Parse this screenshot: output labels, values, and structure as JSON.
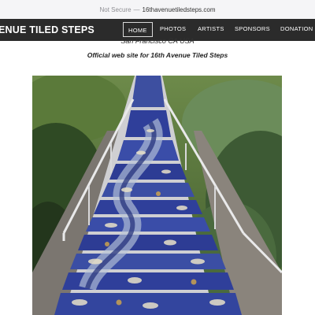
{
  "browser": {
    "secure_label": "Not Secure",
    "separator": "—",
    "url": "16thavenuetiledsteps.com"
  },
  "site": {
    "title": "ENUE TILED STEPS",
    "location": "San Francisco CA USA",
    "tagline": "Official web site for 16th Avenue Tiled Steps"
  },
  "nav": {
    "items": [
      {
        "label": "HOME",
        "active": true
      },
      {
        "label": "PHOTOS"
      },
      {
        "label": "ARTISTS"
      },
      {
        "label": "SPONSORS"
      },
      {
        "label": "DONATION"
      }
    ]
  },
  "photo": {
    "subject": "mosaic-tiled-stairway-photo"
  },
  "colors": {
    "nav_bg": "#2b2b2b",
    "urlbar_bg": "#f5f5f7",
    "mosaic_blue": "#2f3f9a"
  }
}
